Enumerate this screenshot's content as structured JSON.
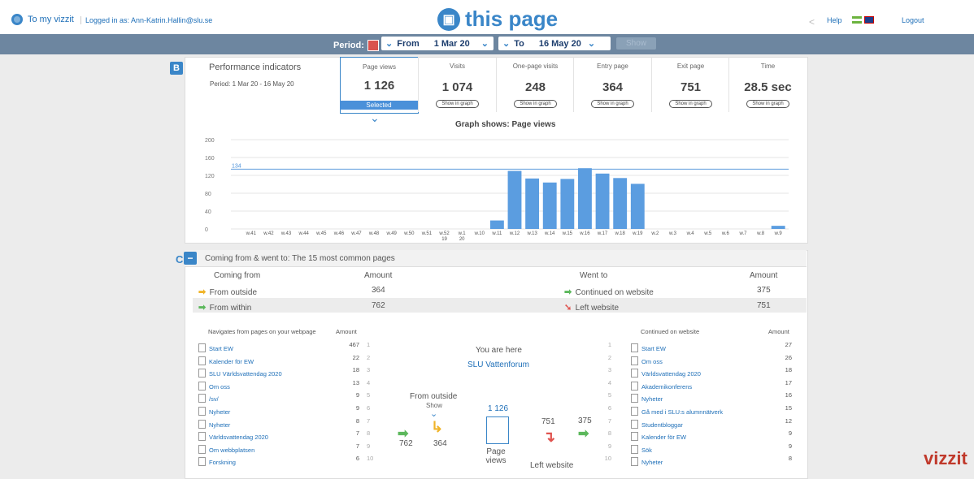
{
  "header": {
    "to_my_vizzit": "To my vizzit",
    "logged_in": "Logged in as: Ann-Katrin.Hallin@slu.se",
    "logo_text": "this page",
    "help": "Help",
    "logout": "Logout"
  },
  "period": {
    "label": "Period:",
    "from_label": "From",
    "from_value": "1 Mar 20",
    "to_label": "To",
    "to_value": "16 May 20",
    "show": "Show"
  },
  "performance": {
    "badge": "B",
    "title": "Performance indicators",
    "period_text": "Period:   1 Mar 20 - 16 May 20",
    "kpis": [
      {
        "label": "Page views",
        "value": "1 126",
        "button": "Selected"
      },
      {
        "label": "Visits",
        "value": "1 074",
        "button": "Show in graph"
      },
      {
        "label": "One-page visits",
        "value": "248",
        "button": "Show in graph"
      },
      {
        "label": "Entry page",
        "value": "364",
        "button": "Show in graph"
      },
      {
        "label": "Exit page",
        "value": "751",
        "button": "Show in graph"
      },
      {
        "label": "Time",
        "value": "28.5 sec",
        "button": "Show in graph"
      }
    ],
    "graph_title": "Graph shows: Page views"
  },
  "chart_data": {
    "type": "bar",
    "title": "Graph shows: Page views",
    "categories": [
      "w.41",
      "w.42",
      "w.43",
      "w.44",
      "w.45",
      "w.46",
      "w.47",
      "w.48",
      "w.49",
      "w.50",
      "w.51",
      "w.52\n19",
      "w.1\n20",
      "w.10",
      "w.11",
      "w.12",
      "w.13",
      "w.14",
      "w.15",
      "w.16",
      "w.17",
      "w.18",
      "w.19",
      "w.2",
      "w.3",
      "w.4",
      "w.5",
      "w.6",
      "w.7",
      "w.8",
      "w.9"
    ],
    "values": [
      0,
      0,
      0,
      0,
      0,
      0,
      0,
      0,
      0,
      0,
      0,
      0,
      0,
      0,
      19,
      130,
      113,
      104,
      112,
      136,
      124,
      114,
      101,
      0,
      0,
      0,
      0,
      0,
      0,
      0,
      7
    ],
    "yticks": [
      0,
      40,
      80,
      120,
      160,
      200
    ],
    "ylim": [
      0,
      200
    ],
    "reference_line": {
      "value": 134,
      "label": "134"
    },
    "grid": true
  },
  "coming": {
    "badge": "C",
    "title": "Coming from & went to: The 15 most common pages",
    "h_coming_from": "Coming from",
    "h_amount": "Amount",
    "h_went_to": "Went to",
    "h_amount2": "Amount",
    "from_outside": "From outside",
    "from_outside_val": "364",
    "from_within": "From within",
    "from_within_val": "762",
    "continued": "Continued on website",
    "continued_val": "375",
    "left": "Left website",
    "left_val": "751",
    "nav_header": "Navigates from pages on your webpage",
    "nav_amount": "Amount",
    "cont_header": "Continued on website",
    "cont_amount": "Amount",
    "you_are_here": "You are here",
    "page_name": "SLU Vattenforum",
    "flow_from_outside": "From outside",
    "flow_show": "Show",
    "flow_762": "762",
    "flow_364": "364",
    "flow_1126": "1 126",
    "flow_page_views": "Page views",
    "flow_751": "751",
    "flow_375": "375",
    "flow_left": "Left website",
    "from_pages": [
      {
        "name": "Start EW",
        "amount": "467",
        "n": "1"
      },
      {
        "name": "Kalender för EW",
        "amount": "22",
        "n": "2"
      },
      {
        "name": "SLU Världsvattendag 2020",
        "amount": "18",
        "n": "3"
      },
      {
        "name": "Om oss",
        "amount": "13",
        "n": "4"
      },
      {
        "name": "/sv/",
        "amount": "9",
        "n": "5"
      },
      {
        "name": "Nyheter",
        "amount": "9",
        "n": "6"
      },
      {
        "name": "Nyheter",
        "amount": "8",
        "n": "7"
      },
      {
        "name": "Världsvattendag 2020",
        "amount": "7",
        "n": "8"
      },
      {
        "name": "Om webbplatsen",
        "amount": "7",
        "n": "9"
      },
      {
        "name": "Forskning",
        "amount": "6",
        "n": "10"
      }
    ],
    "to_pages": [
      {
        "name": "Start EW",
        "amount": "27",
        "n": "1"
      },
      {
        "name": "Om oss",
        "amount": "26",
        "n": "2"
      },
      {
        "name": "Världsvattendag 2020",
        "amount": "18",
        "n": "3"
      },
      {
        "name": "Akademikonferens",
        "amount": "17",
        "n": "4"
      },
      {
        "name": "Nyheter",
        "amount": "16",
        "n": "5"
      },
      {
        "name": "Gå med i SLU:s alumnnätverk",
        "amount": "15",
        "n": "6"
      },
      {
        "name": "Studentbloggar",
        "amount": "12",
        "n": "7"
      },
      {
        "name": "Kalender för EW",
        "amount": "9",
        "n": "8"
      },
      {
        "name": "Sök",
        "amount": "9",
        "n": "9"
      },
      {
        "name": "Nyheter",
        "amount": "8",
        "n": "10"
      }
    ]
  },
  "brand": "vizzit"
}
